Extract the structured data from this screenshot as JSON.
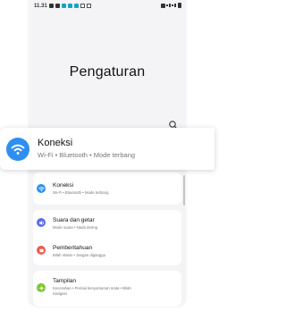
{
  "status_bar": {
    "time": "11.31"
  },
  "page_title": "Pengaturan",
  "highlight": {
    "title": "Koneksi",
    "subtitle": "Wi-Fi  •  Bluetooth  •  Mode terbang"
  },
  "settings": [
    {
      "title": "Koneksi",
      "subtitle": "Wi-Fi  •  Bluetooth  •  Mode terbang",
      "icon": "wifi-icon",
      "color": "#2e8ff0"
    },
    {
      "title": "Suara dan getar",
      "subtitle": "Mode suara  •  Nada dering",
      "icon": "sound-icon",
      "color": "#5b6ee8"
    },
    {
      "title": "Pemberitahuan",
      "subtitle": "Bilah status  •  Jangan diganggu",
      "icon": "notification-icon",
      "color": "#ee5a4f"
    },
    {
      "title": "Tampilan",
      "subtitle_1": "Kecerahan  •  Perisai kenyamanan mata  •  Bilah",
      "subtitle_2": "navigasi",
      "icon": "display-icon",
      "color": "#7bc62d"
    }
  ]
}
